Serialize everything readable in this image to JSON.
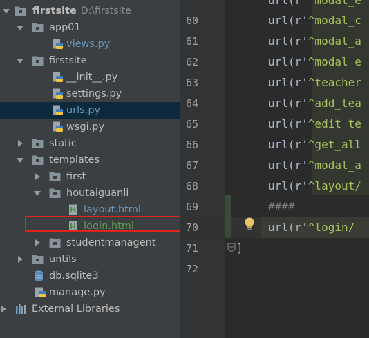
{
  "project_tree": {
    "items": [
      {
        "label": "firstsite",
        "sublabel": "D:\\firstsite",
        "type": "folder",
        "bold": true
      },
      {
        "label": "app01",
        "type": "folder"
      },
      {
        "label": "views.py",
        "type": "python"
      },
      {
        "label": "firstsite",
        "type": "folder"
      },
      {
        "label": "__init__.py",
        "type": "python"
      },
      {
        "label": "settings.py",
        "type": "python"
      },
      {
        "label": "urls.py",
        "type": "python",
        "selected": true
      },
      {
        "label": "wsgi.py",
        "type": "python"
      },
      {
        "label": "static",
        "type": "folder"
      },
      {
        "label": "templates",
        "type": "folder"
      },
      {
        "label": "first",
        "type": "folder"
      },
      {
        "label": "houtaiguanli",
        "type": "folder"
      },
      {
        "label": "layout.html",
        "type": "html"
      },
      {
        "label": "login.html",
        "type": "html",
        "highlighted": true
      },
      {
        "label": "studentmanagent",
        "type": "folder"
      },
      {
        "label": "untils",
        "type": "folder"
      },
      {
        "label": "db.sqlite3",
        "type": "database"
      },
      {
        "label": "manage.py",
        "type": "python"
      },
      {
        "label": "External Libraries",
        "type": "library"
      }
    ]
  },
  "editor": {
    "lines": [
      {
        "num": "60",
        "prefix": "url(r'",
        "str": "^modal_c"
      },
      {
        "num": "61",
        "prefix": "url(r'",
        "str": "^modal_a"
      },
      {
        "num": "62",
        "prefix": "url(r'",
        "str": "^modal_e"
      },
      {
        "num": "63",
        "prefix": "url(r'",
        "str": "^teacher"
      },
      {
        "num": "64",
        "prefix": "url(r'",
        "str": "^add_tea"
      },
      {
        "num": "65",
        "prefix": "url(r'",
        "str": "^edit_te"
      },
      {
        "num": "66",
        "prefix": "url(r'",
        "str": "^get_all"
      },
      {
        "num": "67",
        "prefix": "url(r'",
        "str": "^modal_a"
      },
      {
        "num": "68",
        "prefix": "url(r'",
        "str": "^layout/"
      },
      {
        "num": "69",
        "prefix": "####",
        "str": ""
      },
      {
        "num": "70",
        "prefix": "url(r'",
        "str": "^login/"
      },
      {
        "num": "71",
        "prefix": "]",
        "str": ""
      },
      {
        "num": "72",
        "prefix": "",
        "str": ""
      }
    ],
    "top_partial": {
      "prefix": "url(r'",
      "str": "^modal_e"
    }
  },
  "colors": {
    "tree_bg": "#3c3f41",
    "editor_bg": "#2b2b2b",
    "selected_row": "#0d293e",
    "highlight_box": "#e0241c",
    "string": "#a5c25c",
    "blue_file": "#6897bb",
    "green_file": "#629755"
  }
}
